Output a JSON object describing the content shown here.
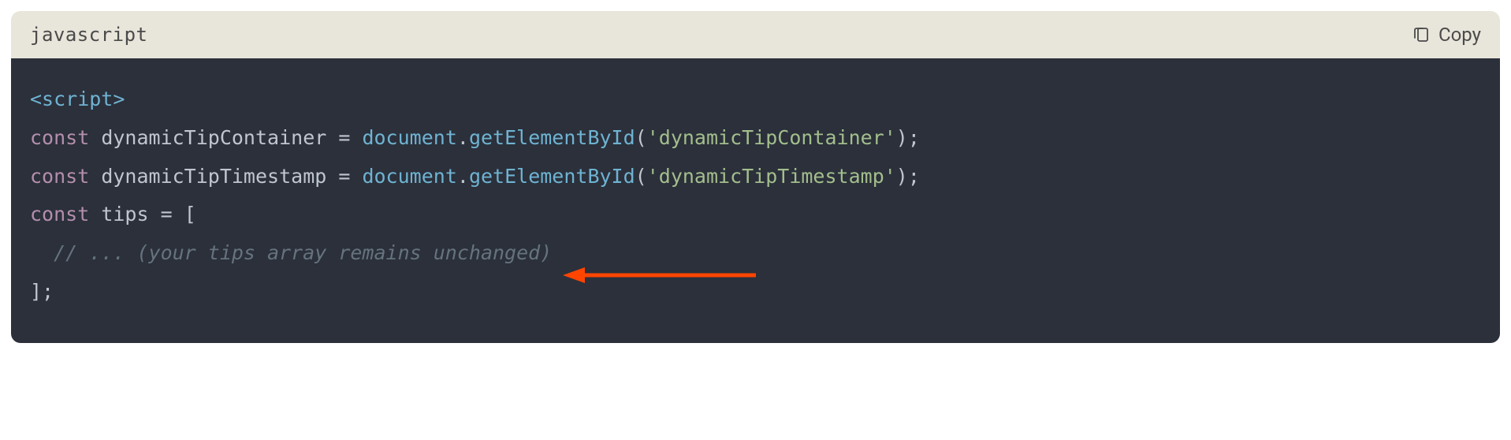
{
  "header": {
    "language": "javascript",
    "copy_label": "Copy"
  },
  "code": {
    "line1": {
      "open_tag": "<script>"
    },
    "line2": {
      "kw": "const",
      "ident": " dynamicTipContainer ",
      "op": "=",
      "obj": " document",
      "dot": ".",
      "method": "getElementById",
      "paren_open": "(",
      "str": "'dynamicTipContainer'",
      "paren_close": ")",
      "semi": ";"
    },
    "line3": {
      "kw": "const",
      "ident": " dynamicTipTimestamp ",
      "op": "=",
      "obj": " document",
      "dot": ".",
      "method": "getElementById",
      "paren_open": "(",
      "str": "'dynamicTipTimestamp'",
      "paren_close": ")",
      "semi": ";"
    },
    "line4": {
      "kw": "const",
      "ident": " tips ",
      "op": "=",
      "bracket": " ["
    },
    "line5": {
      "comment": "  // ... (your tips array remains unchanged)"
    },
    "line6": {
      "bracket": "];"
    }
  },
  "annotation": {
    "arrow_color": "#ff4500"
  }
}
